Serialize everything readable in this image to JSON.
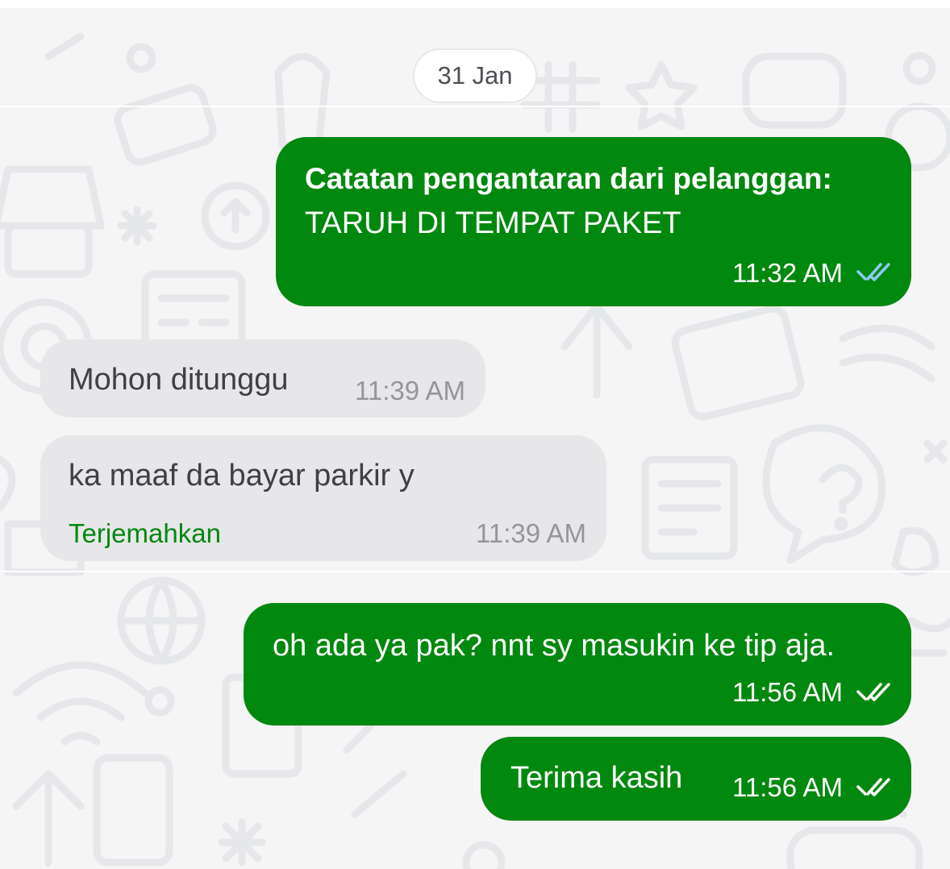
{
  "date_separator": "31 Jan",
  "messages": [
    {
      "direction": "outgoing",
      "title": "Catatan pengantaran dari pelanggan:",
      "text": "TARUH DI TEMPAT PAKET",
      "time": "11:32 AM",
      "status": "delivered",
      "status_icon": "double-check-icon",
      "status_color": "#8ec9f0"
    },
    {
      "direction": "incoming",
      "text": "Mohon ditunggu",
      "time": "11:39 AM"
    },
    {
      "direction": "incoming",
      "text": "ka maaf da bayar parkir y",
      "translate_label": "Terjemahkan",
      "time": "11:39 AM"
    },
    {
      "direction": "outgoing",
      "text": "oh ada ya pak? nnt sy masukin ke tip aja.",
      "time": "11:56 AM",
      "status": "read",
      "status_icon": "double-check-icon",
      "status_color": "#ffffff"
    },
    {
      "direction": "outgoing",
      "text": "Terima kasih",
      "time": "11:56 AM",
      "status": "read",
      "status_icon": "double-check-icon",
      "status_color": "#ffffff"
    }
  ],
  "colors": {
    "outgoing_bubble": "#00880f",
    "incoming_bubble": "#e7e7e9",
    "chat_background": "#f5f5f6",
    "translate_link": "#00880f"
  }
}
